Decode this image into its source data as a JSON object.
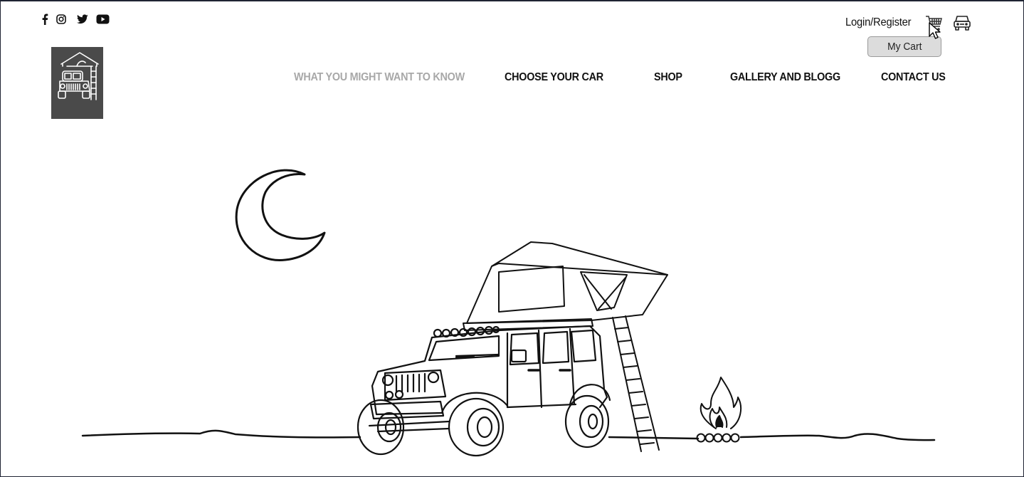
{
  "header": {
    "social": [
      {
        "name": "facebook",
        "icon": "facebook-icon"
      },
      {
        "name": "instagram",
        "icon": "instagram-icon"
      },
      {
        "name": "twitter",
        "icon": "twitter-icon"
      },
      {
        "name": "youtube",
        "icon": "youtube-icon"
      }
    ],
    "login_label": "Login/Register",
    "cart_icon": "cart-icon",
    "car_icon": "car-icon",
    "cart_tooltip": "My Cart"
  },
  "nav": {
    "items": [
      {
        "label": "WHAT YOU MIGHT WANT TO KNOW",
        "active": false,
        "muted": true
      },
      {
        "label": "CHOOSE YOUR CAR"
      },
      {
        "label": "SHOP"
      },
      {
        "label": "GALLERY AND BLOGG"
      },
      {
        "label": "CONTACT US"
      }
    ]
  },
  "colors": {
    "logo_bg": "#4a4a4a",
    "muted_nav": "#a8a8a8",
    "text": "#111111",
    "tooltip_bg": "#dcdcdc"
  },
  "hero": {
    "illustration": "jeep-with-rooftop-tent-moon-campfire"
  }
}
